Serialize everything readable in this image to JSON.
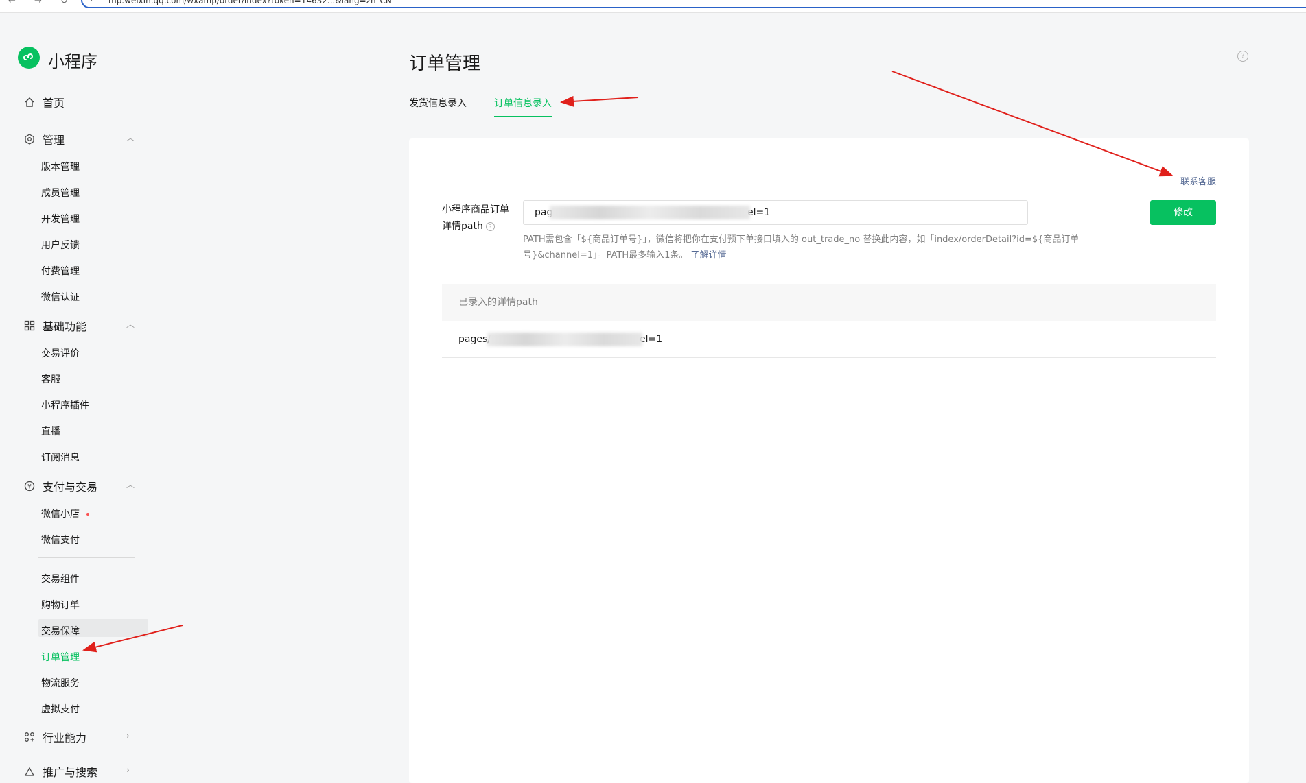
{
  "browser": {
    "back": "←",
    "forward": "→",
    "reload": "↻",
    "url_fragment": "mp.weixin.qq.com/wxamp/order/index?token=14632...&lang=zh_CN"
  },
  "app": {
    "name": "小程序"
  },
  "sidebar": {
    "home": "首页",
    "groups": [
      {
        "label": "管理",
        "items": [
          "版本管理",
          "成员管理",
          "开发管理",
          "用户反馈",
          "付费管理",
          "微信认证"
        ]
      },
      {
        "label": "基础功能",
        "items": [
          "交易评价",
          "客服",
          "小程序插件",
          "直播",
          "订阅消息"
        ]
      },
      {
        "label": "支付与交易",
        "items": [
          "微信小店",
          "微信支付",
          "交易组件",
          "购物订单",
          "交易保障",
          "订单管理",
          "物流服务",
          "虚拟支付"
        ]
      },
      {
        "label": "行业能力"
      },
      {
        "label": "推广与搜索"
      }
    ]
  },
  "main": {
    "title": "订单管理",
    "tabs": [
      "发货信息录入",
      "订单信息录入"
    ],
    "active_tab": "订单信息录入",
    "contact": "联系客服",
    "form": {
      "label": "小程序商品订单详情path",
      "input_visible_prefix": "pag",
      "input_visible_suffix": "el=1",
      "button": "修改",
      "hint": "PATH需包含「${商品订单号}」，微信将把你在支付预下单接口填入的 out_trade_no 替换此内容，如「index/orderDetail?id=${商品订单号}&channel=1」。PATH最多输入1条。",
      "hint_link": "了解详情"
    },
    "list": {
      "header": "已录入的详情path",
      "row_prefix": "pages/",
      "row_suffix": "el=1"
    }
  },
  "colors": {
    "accent": "#07c160",
    "link": "#576b95",
    "annotation": "#e0201b"
  }
}
